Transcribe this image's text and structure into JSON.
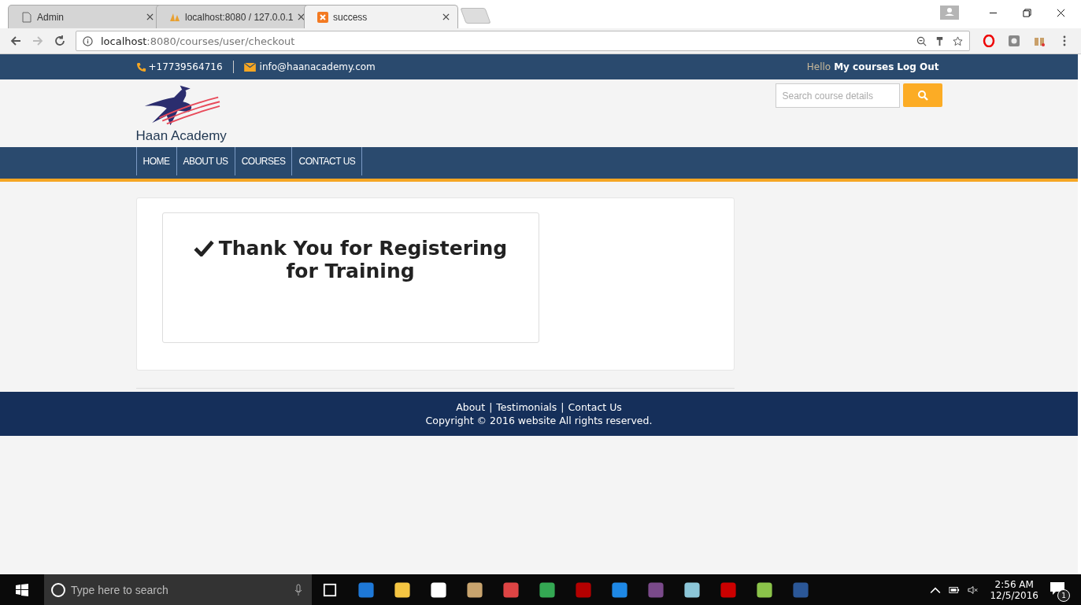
{
  "browser": {
    "tabs": [
      {
        "title": "Admin",
        "selected": false
      },
      {
        "title": "localhost:8080 / 127.0.0.1",
        "selected": false
      },
      {
        "title": "success",
        "selected": true
      }
    ],
    "url_host": "localhost",
    "url_path": ":8080/courses/user/checkout"
  },
  "top_bar": {
    "phone": "+17739564716",
    "email": "info@haanacademy.com",
    "greeting": "Hello",
    "links": [
      "My courses",
      "Log Out"
    ]
  },
  "header": {
    "logo_text": "Haan Academy",
    "search": {
      "placeholder": "Search course details"
    }
  },
  "nav": [
    "HOME",
    "ABOUT US",
    "COURSES",
    "CONTACT US"
  ],
  "message": {
    "title": "Thank You for Registering for Training"
  },
  "footer": {
    "links": [
      "About",
      "Testimonials",
      "Contact Us"
    ],
    "separator": "|",
    "copyright": "Copyright © 2016 website All rights reserved."
  },
  "taskbar": {
    "search": {
      "placeholder": "Type here to search"
    },
    "time": "2:56 AM",
    "date": "12/5/2016",
    "notifications": "1"
  }
}
